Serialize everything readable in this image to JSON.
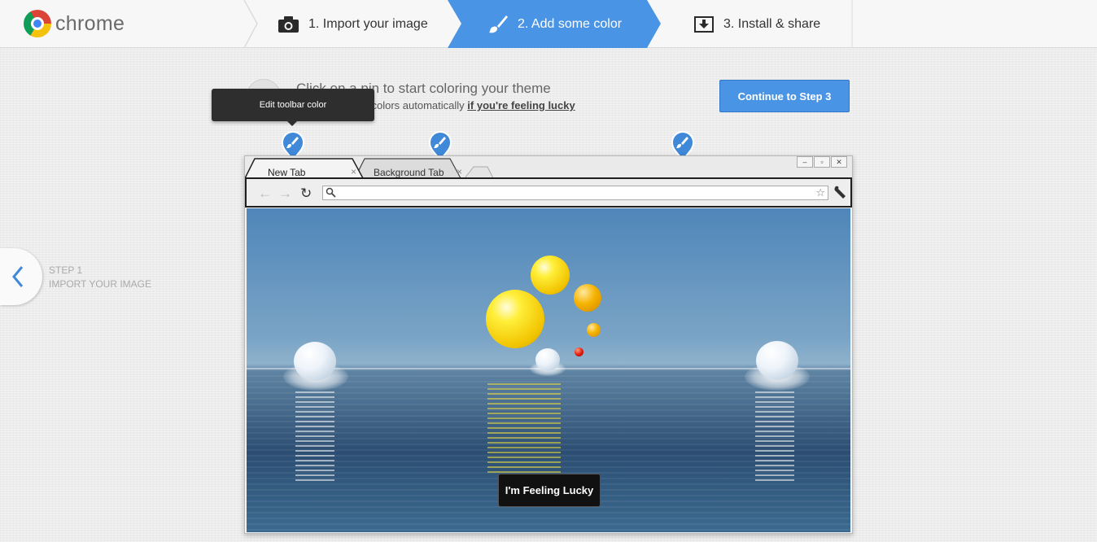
{
  "brand": {
    "name": "chrome"
  },
  "steps": [
    {
      "label": "1. Import your image",
      "icon": "camera-icon",
      "active": false
    },
    {
      "label": "2. Add some color",
      "icon": "paintbrush-icon",
      "active": true
    },
    {
      "label": "3. Install & share",
      "icon": "download-icon",
      "active": false
    }
  ],
  "colors": {
    "accent": "#4a94e6",
    "header_bg": "#f7f7f7",
    "tooltip_bg": "#2e2e2e"
  },
  "instructions": {
    "title": "Click on a pin to start coloring your theme",
    "sub_prefix": "Or you can add colors automatically ",
    "sub_link": "if you're feeling lucky"
  },
  "continue_button": "Continue to Step 3",
  "tooltip": "Edit toolbar color",
  "back": {
    "line1": "STEP 1",
    "line2": "IMPORT YOUR IMAGE"
  },
  "preview": {
    "tabs": [
      {
        "label": "New Tab",
        "close": "×"
      },
      {
        "label": "Background Tab",
        "close": "×"
      }
    ],
    "window_controls": [
      "–",
      "▫",
      "✕"
    ],
    "lucky_button": "I'm Feeling Lucky"
  }
}
